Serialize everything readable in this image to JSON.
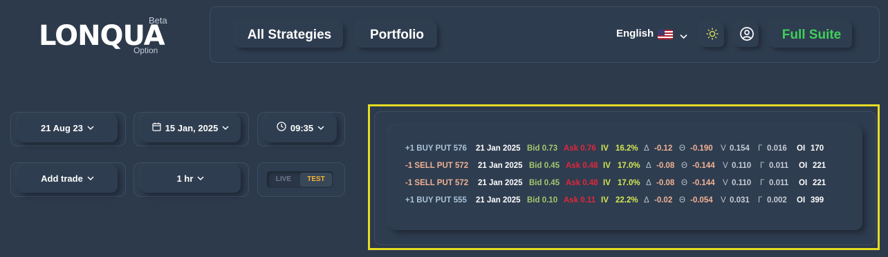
{
  "brand": {
    "name": "LONQUA",
    "badge": "Beta",
    "sub": "Option"
  },
  "header": {
    "nav": [
      "All Strategies",
      "Portfolio"
    ],
    "language": "English",
    "full_suite": "Full Suite"
  },
  "controls": {
    "start_date": "21 Aug 23",
    "expiry_date": "15 Jan, 2025",
    "time": "09:35",
    "add_trade": "Add trade",
    "interval": "1 hr",
    "mode_live": "LIVE",
    "mode_test": "TEST",
    "mode_selected": "TEST"
  },
  "trades": [
    {
      "action": "+1 BUY PUT 576",
      "side": "buy",
      "date": "21 Jan 2025",
      "bid": "Bid 0.73",
      "ask": "Ask 0.76",
      "iv_label": "IV",
      "iv": "16.2%",
      "delta_sym": "Δ",
      "delta": "-0.12",
      "theta_sym": "Θ",
      "theta": "-0.190",
      "vega_sym": "V",
      "vega": "0.154",
      "gamma_sym": "Γ",
      "gamma": "0.016",
      "oi_label": "OI",
      "oi": "170"
    },
    {
      "action": "-1 SELL PUT 572",
      "side": "sell",
      "date": "21 Jan 2025",
      "bid": "Bid 0.45",
      "ask": "Ask 0.48",
      "iv_label": "IV",
      "iv": "17.0%",
      "delta_sym": "Δ",
      "delta": "-0.08",
      "theta_sym": "Θ",
      "theta": "-0.144",
      "vega_sym": "V",
      "vega": "0.110",
      "gamma_sym": "Γ",
      "gamma": "0.011",
      "oi_label": "OI",
      "oi": "221"
    },
    {
      "action": "-1 SELL PUT 572",
      "side": "sell",
      "date": "21 Jan 2025",
      "bid": "Bid 0.45",
      "ask": "Ask 0.48",
      "iv_label": "IV",
      "iv": "17.0%",
      "delta_sym": "Δ",
      "delta": "-0.08",
      "theta_sym": "Θ",
      "theta": "-0.144",
      "vega_sym": "V",
      "vega": "0.110",
      "gamma_sym": "Γ",
      "gamma": "0.011",
      "oi_label": "OI",
      "oi": "221"
    },
    {
      "action": "+1 BUY PUT 555",
      "side": "buy",
      "date": "21 Jan 2025",
      "bid": "Bid 0.10",
      "ask": "Ask 0.11",
      "iv_label": "IV",
      "iv": "22.2%",
      "delta_sym": "Δ",
      "delta": "-0.02",
      "theta_sym": "Θ",
      "theta": "-0.054",
      "vega_sym": "V",
      "vega": "0.031",
      "gamma_sym": "Γ",
      "gamma": "0.002",
      "oi_label": "OI",
      "oi": "399"
    }
  ],
  "colors": {
    "background": "#2d3a4c",
    "accent_green": "#3fcf5a",
    "highlight": "#e6dc23",
    "ask_red": "#e0263b",
    "bid_green": "#a4c76e",
    "test_orange": "#f2b430"
  },
  "icons": [
    "us-flag-icon",
    "chevron-down-icon",
    "sun-icon",
    "user-icon",
    "calendar-icon",
    "clock-icon"
  ]
}
